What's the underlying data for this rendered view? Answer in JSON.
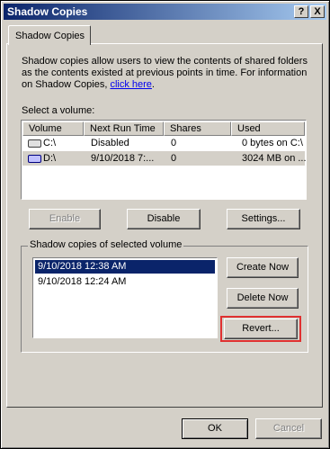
{
  "window": {
    "title": "Shadow Copies",
    "help_btn": "?",
    "close_btn": "X"
  },
  "tab": {
    "label": "Shadow Copies"
  },
  "description": {
    "text": "Shadow copies allow users to view the contents of shared folders as the contents existed at previous points in time. For information on Shadow Copies, ",
    "link": "click here",
    "end": "."
  },
  "volumes": {
    "label": "Select a volume:",
    "columns": [
      "Volume",
      "Next Run Time",
      "Shares",
      "Used"
    ],
    "rows": [
      {
        "volume": "C:\\",
        "next_run": "Disabled",
        "shares": "0",
        "used": "0 bytes on C:\\",
        "icon": "hard-drive-icon"
      },
      {
        "volume": "D:\\",
        "next_run": "9/10/2018 7:...",
        "shares": "0",
        "used": "3024 MB on ...",
        "icon": "scheduled-drive-icon"
      }
    ]
  },
  "buttons": {
    "enable": "Enable",
    "disable": "Disable",
    "settings": "Settings..."
  },
  "shadow_group": {
    "label": "Shadow copies of selected volume",
    "items": [
      "9/10/2018 12:38 AM",
      "9/10/2018 12:24 AM"
    ],
    "create_now": "Create Now",
    "delete_now": "Delete Now",
    "revert": "Revert..."
  },
  "footer": {
    "ok": "OK",
    "cancel": "Cancel"
  },
  "colors": {
    "face": "#d4d0c8",
    "title_start": "#0a246a",
    "title_end": "#a6caf0",
    "selection": "#0a246a",
    "highlight_ring": "#e03030"
  }
}
